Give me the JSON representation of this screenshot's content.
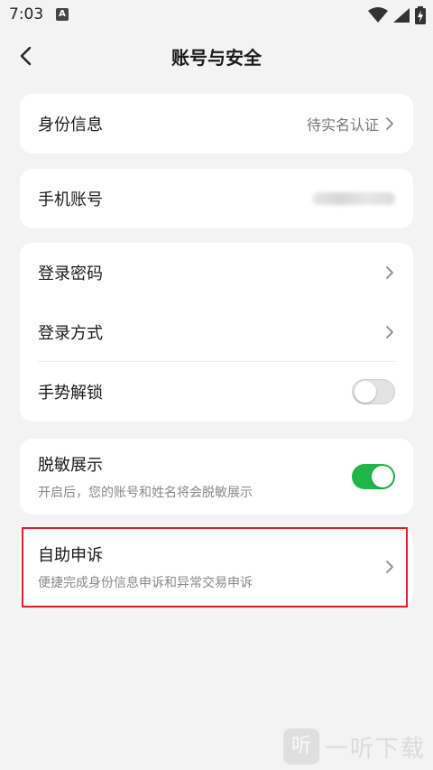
{
  "status_bar": {
    "time": "7:03",
    "notification_letter": "A",
    "icons": [
      "wifi-icon",
      "signal-icon",
      "battery-charging-icon"
    ]
  },
  "header": {
    "title": "账号与安全",
    "back_icon": "chevron-left-icon"
  },
  "identity": {
    "label": "身份信息",
    "value": "待实名认证"
  },
  "phone": {
    "label": "手机账号",
    "value_blurred": true
  },
  "login_group": {
    "password": {
      "label": "登录密码"
    },
    "method": {
      "label": "登录方式"
    },
    "gesture": {
      "label": "手势解锁",
      "enabled": false
    }
  },
  "desensitize": {
    "title": "脱敏展示",
    "subtitle": "开启后，您的账号和姓名将会脱敏展示",
    "enabled": true
  },
  "appeal": {
    "title": "自助申诉",
    "subtitle": "便捷完成身份信息申诉和异常交易申诉"
  },
  "watermark": {
    "logo": "听",
    "text": "一听下载"
  },
  "colors": {
    "background": "#f3f3f3",
    "card": "#ffffff",
    "toggle_on": "#20b64a",
    "highlight_border": "#e0201c"
  }
}
